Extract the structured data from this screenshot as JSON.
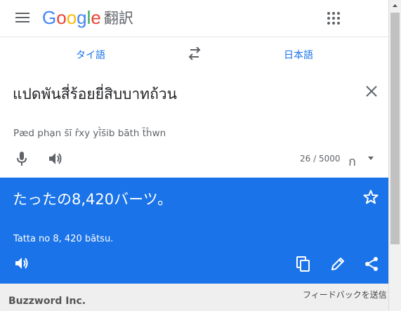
{
  "header": {
    "logo_letters": [
      {
        "ch": "G",
        "color": "#4285f4"
      },
      {
        "ch": "o",
        "color": "#ea4335"
      },
      {
        "ch": "o",
        "color": "#fbbc05"
      },
      {
        "ch": "g",
        "color": "#4285f4"
      },
      {
        "ch": "l",
        "color": "#34a853"
      },
      {
        "ch": "e",
        "color": "#ea4335"
      }
    ],
    "logo_suffix": "翻訳",
    "menu_icon": "hamburger-menu-icon",
    "apps_icon": "apps-grid-icon"
  },
  "language_bar": {
    "source_language": "タイ語",
    "target_language": "日本語",
    "swap_icon": "swap-arrows-icon"
  },
  "source": {
    "text": "แปดพันสี่ร้อยยี่สิบบาทถ้วน",
    "transliteration": "Pæd phạn s̄ī r̂xy yī̀s̄ib bāth t̄ĥwn",
    "char_count": "26 / 5000",
    "keyboard_glyph": "ก",
    "icons": [
      "close-icon",
      "microphone-icon",
      "speaker-icon",
      "thai-keyboard-icon"
    ]
  },
  "translation": {
    "text": "たったの8,420バーツ。",
    "transliteration": "Tatta no 8, 420 bātsu.",
    "icons": [
      "star-icon",
      "speaker-icon",
      "copy-icon",
      "edit-icon",
      "share-icon"
    ]
  },
  "footer": {
    "feedback": "フィードバックを送信",
    "company": "Buzzword Inc."
  },
  "colors": {
    "accent": "#1a73e8",
    "icon_gray": "#5f6368"
  }
}
